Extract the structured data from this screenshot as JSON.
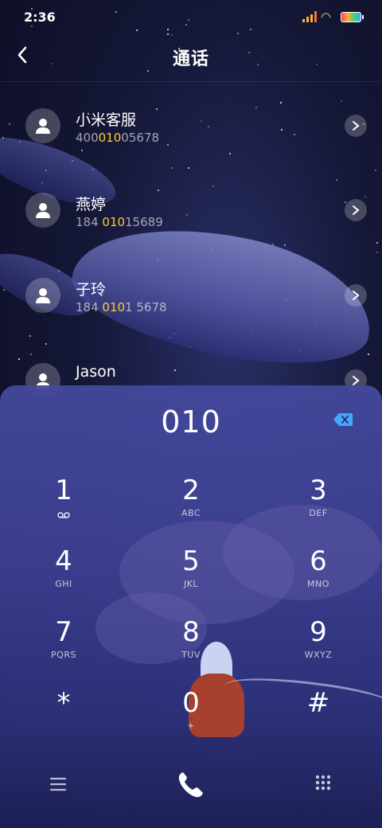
{
  "status_bar": {
    "time": "2:36"
  },
  "header": {
    "title": "通话",
    "back_icon": "back-arrow-icon"
  },
  "contacts": [
    {
      "name": "小米客服",
      "number_pre": "400",
      "number_match": "010",
      "number_post": "05678"
    },
    {
      "name": "燕婷",
      "number_pre": "184 ",
      "number_match": "010",
      "number_post": "15689"
    },
    {
      "name": "子玲",
      "number_pre": "184 ",
      "number_match": "010",
      "number_post": "1 5678"
    },
    {
      "name": "Jason",
      "number_pre": "",
      "number_match": "",
      "number_post": ""
    }
  ],
  "dialpad": {
    "input": "010",
    "keys": [
      {
        "digit": "1",
        "letters": ""
      },
      {
        "digit": "2",
        "letters": "ABC"
      },
      {
        "digit": "3",
        "letters": "DEF"
      },
      {
        "digit": "4",
        "letters": "GHI"
      },
      {
        "digit": "5",
        "letters": "JKL"
      },
      {
        "digit": "6",
        "letters": "MNO"
      },
      {
        "digit": "7",
        "letters": "PQRS"
      },
      {
        "digit": "8",
        "letters": "TUV"
      },
      {
        "digit": "9",
        "letters": "WXYZ"
      },
      {
        "digit": "*",
        "letters": ""
      },
      {
        "digit": "0",
        "letters": "+"
      },
      {
        "digit": "#",
        "letters": ""
      }
    ]
  },
  "colors": {
    "highlight": "#ffcc33",
    "accent_blue": "#3fa9ff"
  }
}
